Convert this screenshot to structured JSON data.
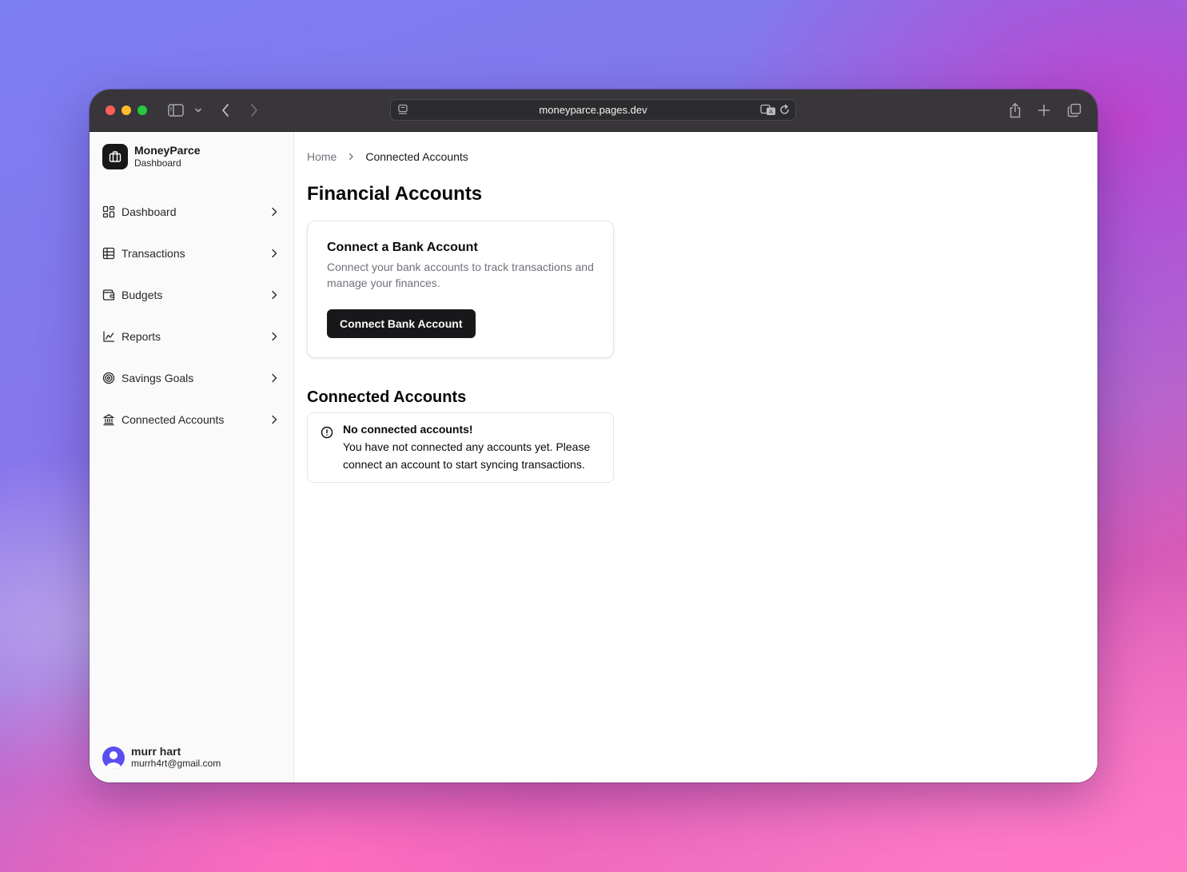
{
  "browser": {
    "url": "moneyparce.pages.dev"
  },
  "sidebar": {
    "brand_name": "MoneyParce",
    "brand_subtitle": "Dashboard",
    "items": [
      {
        "label": "Dashboard",
        "icon": "layout-dashboard-icon"
      },
      {
        "label": "Transactions",
        "icon": "table-icon"
      },
      {
        "label": "Budgets",
        "icon": "wallet-icon"
      },
      {
        "label": "Reports",
        "icon": "chart-line-icon"
      },
      {
        "label": "Savings Goals",
        "icon": "target-icon"
      },
      {
        "label": "Connected Accounts",
        "icon": "landmark-icon"
      }
    ],
    "user": {
      "name": "murr hart",
      "email": "murrh4rt@gmail.com"
    }
  },
  "main": {
    "breadcrumb": {
      "home": "Home",
      "current": "Connected Accounts"
    },
    "title": "Financial Accounts",
    "connect_card": {
      "title": "Connect a Bank Account",
      "description": "Connect your bank accounts to track transactions and manage your finances.",
      "button_label": "Connect Bank Account"
    },
    "connected_section": {
      "title": "Connected Accounts",
      "alert_title": "No connected accounts!",
      "alert_description": "You have not connected any accounts yet. Please connect an account to start syncing transactions."
    }
  },
  "colors": {
    "primary": "#18181b",
    "muted_text": "#71717a",
    "border": "#e4e4e7",
    "sidebar_bg": "#fafafa",
    "avatar": "#5b4ef0"
  }
}
